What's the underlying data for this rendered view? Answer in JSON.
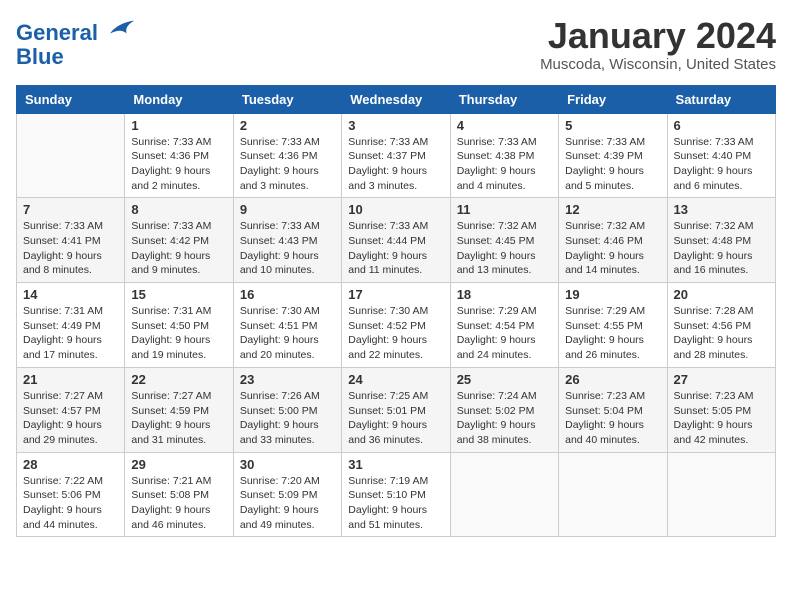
{
  "header": {
    "logo_line1": "General",
    "logo_line2": "Blue",
    "month": "January 2024",
    "location": "Muscoda, Wisconsin, United States"
  },
  "weekdays": [
    "Sunday",
    "Monday",
    "Tuesday",
    "Wednesday",
    "Thursday",
    "Friday",
    "Saturday"
  ],
  "weeks": [
    [
      {
        "day": "",
        "sunrise": "",
        "sunset": "",
        "daylight": ""
      },
      {
        "day": "1",
        "sunrise": "Sunrise: 7:33 AM",
        "sunset": "Sunset: 4:36 PM",
        "daylight": "Daylight: 9 hours and 2 minutes."
      },
      {
        "day": "2",
        "sunrise": "Sunrise: 7:33 AM",
        "sunset": "Sunset: 4:36 PM",
        "daylight": "Daylight: 9 hours and 3 minutes."
      },
      {
        "day": "3",
        "sunrise": "Sunrise: 7:33 AM",
        "sunset": "Sunset: 4:37 PM",
        "daylight": "Daylight: 9 hours and 3 minutes."
      },
      {
        "day": "4",
        "sunrise": "Sunrise: 7:33 AM",
        "sunset": "Sunset: 4:38 PM",
        "daylight": "Daylight: 9 hours and 4 minutes."
      },
      {
        "day": "5",
        "sunrise": "Sunrise: 7:33 AM",
        "sunset": "Sunset: 4:39 PM",
        "daylight": "Daylight: 9 hours and 5 minutes."
      },
      {
        "day": "6",
        "sunrise": "Sunrise: 7:33 AM",
        "sunset": "Sunset: 4:40 PM",
        "daylight": "Daylight: 9 hours and 6 minutes."
      }
    ],
    [
      {
        "day": "7",
        "sunrise": "Sunrise: 7:33 AM",
        "sunset": "Sunset: 4:41 PM",
        "daylight": "Daylight: 9 hours and 8 minutes."
      },
      {
        "day": "8",
        "sunrise": "Sunrise: 7:33 AM",
        "sunset": "Sunset: 4:42 PM",
        "daylight": "Daylight: 9 hours and 9 minutes."
      },
      {
        "day": "9",
        "sunrise": "Sunrise: 7:33 AM",
        "sunset": "Sunset: 4:43 PM",
        "daylight": "Daylight: 9 hours and 10 minutes."
      },
      {
        "day": "10",
        "sunrise": "Sunrise: 7:33 AM",
        "sunset": "Sunset: 4:44 PM",
        "daylight": "Daylight: 9 hours and 11 minutes."
      },
      {
        "day": "11",
        "sunrise": "Sunrise: 7:32 AM",
        "sunset": "Sunset: 4:45 PM",
        "daylight": "Daylight: 9 hours and 13 minutes."
      },
      {
        "day": "12",
        "sunrise": "Sunrise: 7:32 AM",
        "sunset": "Sunset: 4:46 PM",
        "daylight": "Daylight: 9 hours and 14 minutes."
      },
      {
        "day": "13",
        "sunrise": "Sunrise: 7:32 AM",
        "sunset": "Sunset: 4:48 PM",
        "daylight": "Daylight: 9 hours and 16 minutes."
      }
    ],
    [
      {
        "day": "14",
        "sunrise": "Sunrise: 7:31 AM",
        "sunset": "Sunset: 4:49 PM",
        "daylight": "Daylight: 9 hours and 17 minutes."
      },
      {
        "day": "15",
        "sunrise": "Sunrise: 7:31 AM",
        "sunset": "Sunset: 4:50 PM",
        "daylight": "Daylight: 9 hours and 19 minutes."
      },
      {
        "day": "16",
        "sunrise": "Sunrise: 7:30 AM",
        "sunset": "Sunset: 4:51 PM",
        "daylight": "Daylight: 9 hours and 20 minutes."
      },
      {
        "day": "17",
        "sunrise": "Sunrise: 7:30 AM",
        "sunset": "Sunset: 4:52 PM",
        "daylight": "Daylight: 9 hours and 22 minutes."
      },
      {
        "day": "18",
        "sunrise": "Sunrise: 7:29 AM",
        "sunset": "Sunset: 4:54 PM",
        "daylight": "Daylight: 9 hours and 24 minutes."
      },
      {
        "day": "19",
        "sunrise": "Sunrise: 7:29 AM",
        "sunset": "Sunset: 4:55 PM",
        "daylight": "Daylight: 9 hours and 26 minutes."
      },
      {
        "day": "20",
        "sunrise": "Sunrise: 7:28 AM",
        "sunset": "Sunset: 4:56 PM",
        "daylight": "Daylight: 9 hours and 28 minutes."
      }
    ],
    [
      {
        "day": "21",
        "sunrise": "Sunrise: 7:27 AM",
        "sunset": "Sunset: 4:57 PM",
        "daylight": "Daylight: 9 hours and 29 minutes."
      },
      {
        "day": "22",
        "sunrise": "Sunrise: 7:27 AM",
        "sunset": "Sunset: 4:59 PM",
        "daylight": "Daylight: 9 hours and 31 minutes."
      },
      {
        "day": "23",
        "sunrise": "Sunrise: 7:26 AM",
        "sunset": "Sunset: 5:00 PM",
        "daylight": "Daylight: 9 hours and 33 minutes."
      },
      {
        "day": "24",
        "sunrise": "Sunrise: 7:25 AM",
        "sunset": "Sunset: 5:01 PM",
        "daylight": "Daylight: 9 hours and 36 minutes."
      },
      {
        "day": "25",
        "sunrise": "Sunrise: 7:24 AM",
        "sunset": "Sunset: 5:02 PM",
        "daylight": "Daylight: 9 hours and 38 minutes."
      },
      {
        "day": "26",
        "sunrise": "Sunrise: 7:23 AM",
        "sunset": "Sunset: 5:04 PM",
        "daylight": "Daylight: 9 hours and 40 minutes."
      },
      {
        "day": "27",
        "sunrise": "Sunrise: 7:23 AM",
        "sunset": "Sunset: 5:05 PM",
        "daylight": "Daylight: 9 hours and 42 minutes."
      }
    ],
    [
      {
        "day": "28",
        "sunrise": "Sunrise: 7:22 AM",
        "sunset": "Sunset: 5:06 PM",
        "daylight": "Daylight: 9 hours and 44 minutes."
      },
      {
        "day": "29",
        "sunrise": "Sunrise: 7:21 AM",
        "sunset": "Sunset: 5:08 PM",
        "daylight": "Daylight: 9 hours and 46 minutes."
      },
      {
        "day": "30",
        "sunrise": "Sunrise: 7:20 AM",
        "sunset": "Sunset: 5:09 PM",
        "daylight": "Daylight: 9 hours and 49 minutes."
      },
      {
        "day": "31",
        "sunrise": "Sunrise: 7:19 AM",
        "sunset": "Sunset: 5:10 PM",
        "daylight": "Daylight: 9 hours and 51 minutes."
      },
      {
        "day": "",
        "sunrise": "",
        "sunset": "",
        "daylight": ""
      },
      {
        "day": "",
        "sunrise": "",
        "sunset": "",
        "daylight": ""
      },
      {
        "day": "",
        "sunrise": "",
        "sunset": "",
        "daylight": ""
      }
    ]
  ]
}
